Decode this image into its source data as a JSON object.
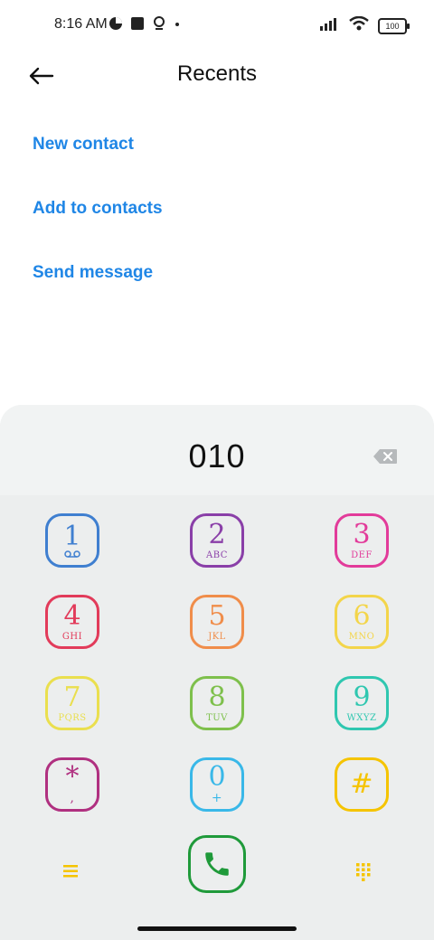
{
  "status": {
    "time": "8:16 AM",
    "battery": "100",
    "icons_left": [
      "circle-half-icon",
      "square-icon",
      "location-pin-icon",
      "dot-icon"
    ],
    "icons_right": [
      "signal-icon",
      "wifi-icon",
      "battery-icon"
    ]
  },
  "header": {
    "title": "Recents"
  },
  "actions": [
    {
      "label": "New contact"
    },
    {
      "label": "Add to contacts"
    },
    {
      "label": "Send message"
    }
  ],
  "dialer": {
    "number": "010",
    "keys": [
      {
        "digit": "1",
        "sub": "",
        "color": "#3f7fd0"
      },
      {
        "digit": "2",
        "sub": "ABC",
        "color": "#8a3fa8"
      },
      {
        "digit": "3",
        "sub": "DEF",
        "color": "#e23b9a"
      },
      {
        "digit": "4",
        "sub": "GHI",
        "color": "#e23b5a"
      },
      {
        "digit": "5",
        "sub": "JKL",
        "color": "#f08d4a"
      },
      {
        "digit": "6",
        "sub": "MNO",
        "color": "#f3d54a"
      },
      {
        "digit": "7",
        "sub": "PQRS",
        "color": "#eadf4e"
      },
      {
        "digit": "8",
        "sub": "TUV",
        "color": "#7ec04c"
      },
      {
        "digit": "9",
        "sub": "WXYZ",
        "color": "#2fc7b0"
      },
      {
        "digit": "*",
        "sub": ",",
        "color": "#b03080"
      },
      {
        "digit": "0",
        "sub": "+",
        "color": "#39b8e8"
      },
      {
        "digit": "#",
        "sub": "",
        "color": "#f5c400"
      }
    ],
    "call_color": "#1f9a3a",
    "accent": "#f5c400"
  }
}
